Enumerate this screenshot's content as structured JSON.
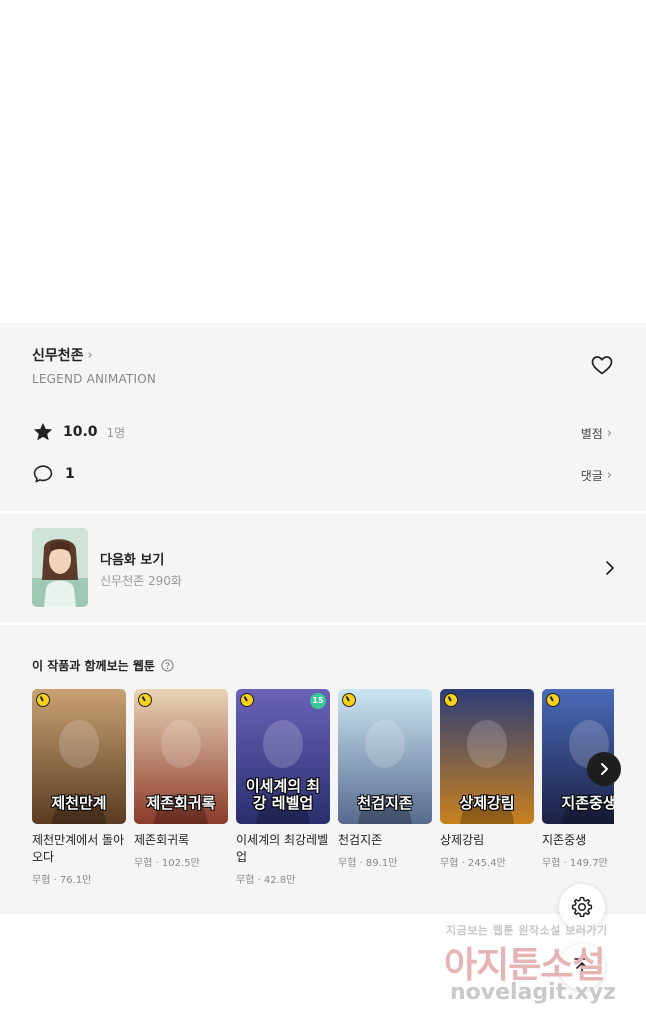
{
  "series": {
    "title": "신무천존",
    "author": "LEGEND ANIMATION",
    "rating_score": "10.0",
    "rating_count": "1명",
    "rate_label": "별점",
    "comment_count": "1",
    "comment_label": "댓글"
  },
  "next_episode": {
    "title": "다음화 보기",
    "subtitle": "신무천존 290화"
  },
  "recommend": {
    "heading": "이 작품과 함께보는 웹툰",
    "items": [
      {
        "title": "제천만계에서 돌아오다",
        "meta": "무협 · 76.1만",
        "cover_text": "제천만계",
        "colors": [
          "#c9a273",
          "#5a3b22"
        ]
      },
      {
        "title": "제존회귀록",
        "meta": "무협 · 102.5만",
        "cover_text": "제존회귀록",
        "colors": [
          "#e9d4b6",
          "#8b3a2a"
        ]
      },
      {
        "title": "이세계의 최강레벨업",
        "meta": "무협 · 42.8만",
        "cover_text": "이세계의 최강 레벨업",
        "badge": "15",
        "colors": [
          "#6a62b8",
          "#2a2f6e"
        ]
      },
      {
        "title": "천검지존",
        "meta": "무협 · 89.1만",
        "cover_text": "천검지존",
        "colors": [
          "#cbe6f2",
          "#566a8e"
        ]
      },
      {
        "title": "상제강림",
        "meta": "무협 · 245.4만",
        "cover_text": "상제강림",
        "colors": [
          "#2c3d78",
          "#c9811f"
        ]
      },
      {
        "title": "지존중생",
        "meta": "무협 · 149.7만",
        "cover_text": "지존중생",
        "colors": [
          "#4a6ab8",
          "#1c2145"
        ]
      }
    ]
  },
  "watermark": {
    "line1": "지금보는 웹툰 원작소설 보러가기",
    "line2": "아지툰소설",
    "line3": "novelagit.xyz"
  },
  "icons": {
    "heart": "heart-outline-icon",
    "star": "star-filled-icon",
    "comment": "speech-bubble-icon",
    "settings": "gear-icon",
    "scroll_top": "arrow-up-icon"
  }
}
